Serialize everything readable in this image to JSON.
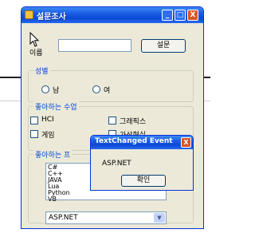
{
  "window": {
    "title": "설문조사",
    "min_glyph": "_",
    "max_glyph": "□",
    "close_glyph": "X"
  },
  "form": {
    "name_label": "이름",
    "name_value": "",
    "submit_label": "설문"
  },
  "gender_group": {
    "title": "성별",
    "options": [
      "남",
      "여"
    ]
  },
  "course_group": {
    "title": "좋아하는 수업",
    "options": [
      "HCI",
      "그래픽스",
      "게임",
      "가상현실"
    ]
  },
  "language_group": {
    "title": "좋아하는 프",
    "list_items": [
      "C#",
      "C++",
      "JAVA",
      "Lua",
      "Python",
      "VB"
    ],
    "combo_value": "ASP.NET",
    "combo_arrow": "▼"
  },
  "message_box": {
    "title": "TextChanged Event",
    "close_glyph": "X",
    "text": "ASP.NET",
    "ok_label": "확인"
  },
  "colors": {
    "titlebar": "#0b49d6",
    "window_bg": "#ece9d8",
    "group_title": "#0046d5",
    "close_button": "#d9542b"
  }
}
